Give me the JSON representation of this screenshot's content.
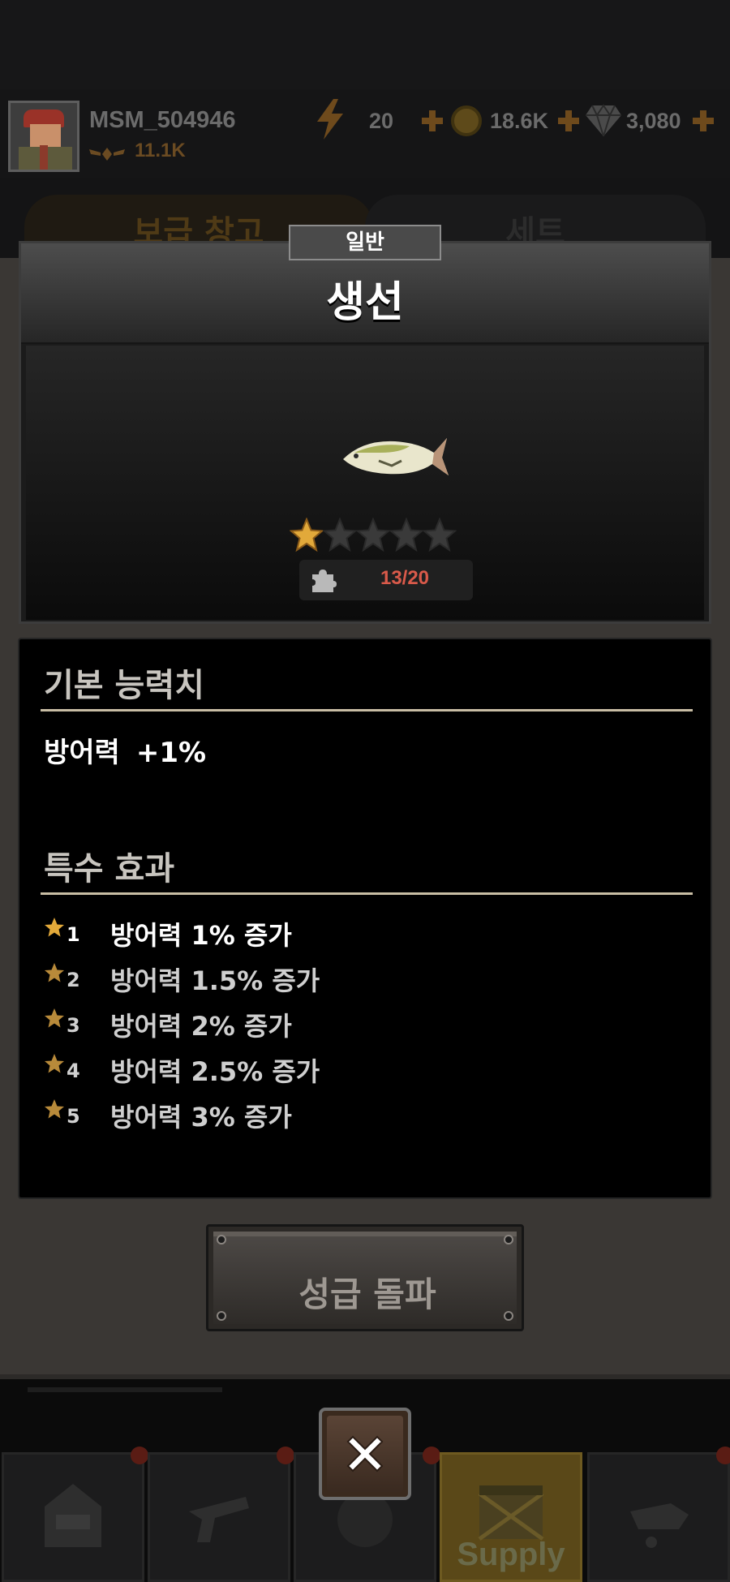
{
  "player": {
    "name": "MSM_504946",
    "rank_power": "11.1K"
  },
  "resources": {
    "energy": "20",
    "coins": "18.6K",
    "gems": "3,080"
  },
  "background_tabs": {
    "supply_warehouse": "보급 창고",
    "set": "세트"
  },
  "item": {
    "grade": "일반",
    "name": "생선",
    "stars_filled": 1,
    "stars_total": 5,
    "pieces": "13/20"
  },
  "base_stats": {
    "heading": "기본 능력치",
    "label": "방어력",
    "value": "+1%"
  },
  "special_effects": {
    "heading": "특수 효과",
    "rows": [
      {
        "level": "1",
        "text": "방어력 1% 증가"
      },
      {
        "level": "2",
        "text": "방어력 1.5% 증가"
      },
      {
        "level": "3",
        "text": "방어력 2% 증가"
      },
      {
        "level": "4",
        "text": "방어력 2.5% 증가"
      },
      {
        "level": "5",
        "text": "방어력 3% 증가"
      }
    ]
  },
  "limit_break_label": "성급 돌파",
  "bottom_nav": {
    "supply_label": "Supply"
  },
  "colors": {
    "star_gold": "#e2a93a",
    "piece_count": "#d95a4a",
    "accent_brown": "#6e4a1c"
  }
}
